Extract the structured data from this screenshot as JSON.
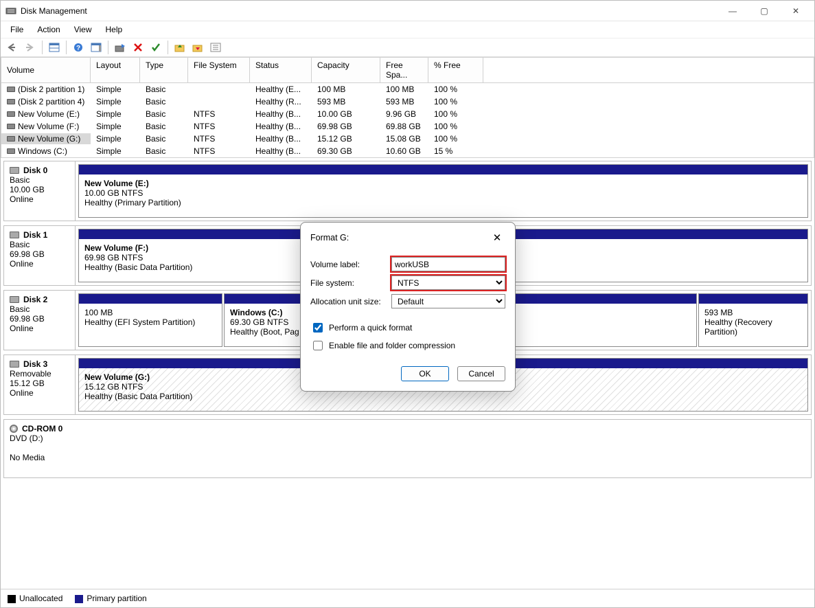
{
  "app_title": "Disk Management",
  "menu": {
    "file": "File",
    "action": "Action",
    "view": "View",
    "help": "Help"
  },
  "win_controls": {
    "min": "—",
    "max": "▢",
    "close": "✕"
  },
  "columns": {
    "volume": "Volume",
    "layout": "Layout",
    "type": "Type",
    "fs": "File System",
    "status": "Status",
    "capacity": "Capacity",
    "free": "Free Spa...",
    "pct": "% Free"
  },
  "volumes": [
    {
      "name": "(Disk 2 partition 1)",
      "layout": "Simple",
      "type": "Basic",
      "fs": "",
      "status": "Healthy (E...",
      "cap": "100 MB",
      "free": "100 MB",
      "pct": "100 %"
    },
    {
      "name": "(Disk 2 partition 4)",
      "layout": "Simple",
      "type": "Basic",
      "fs": "",
      "status": "Healthy (R...",
      "cap": "593 MB",
      "free": "593 MB",
      "pct": "100 %"
    },
    {
      "name": "New Volume (E:)",
      "layout": "Simple",
      "type": "Basic",
      "fs": "NTFS",
      "status": "Healthy (B...",
      "cap": "10.00 GB",
      "free": "9.96 GB",
      "pct": "100 %"
    },
    {
      "name": "New Volume (F:)",
      "layout": "Simple",
      "type": "Basic",
      "fs": "NTFS",
      "status": "Healthy (B...",
      "cap": "69.98 GB",
      "free": "69.88 GB",
      "pct": "100 %"
    },
    {
      "name": "New Volume (G:)",
      "layout": "Simple",
      "type": "Basic",
      "fs": "NTFS",
      "status": "Healthy (B...",
      "cap": "15.12 GB",
      "free": "15.08 GB",
      "pct": "100 %",
      "selected": true
    },
    {
      "name": "Windows (C:)",
      "layout": "Simple",
      "type": "Basic",
      "fs": "NTFS",
      "status": "Healthy (B...",
      "cap": "69.30 GB",
      "free": "10.60 GB",
      "pct": "15 %"
    }
  ],
  "disks": {
    "d0": {
      "title": "Disk 0",
      "type": "Basic",
      "size": "10.00 GB",
      "state": "Online",
      "p0": {
        "name": "New Volume  (E:)",
        "size": "10.00 GB NTFS",
        "status": "Healthy (Primary Partition)"
      }
    },
    "d1": {
      "title": "Disk 1",
      "type": "Basic",
      "size": "69.98 GB",
      "state": "Online",
      "p0": {
        "name": "New Volume  (F:)",
        "size": "69.98 GB NTFS",
        "status": "Healthy (Basic Data Partition)"
      }
    },
    "d2": {
      "title": "Disk 2",
      "type": "Basic",
      "size": "69.98 GB",
      "state": "Online",
      "p0": {
        "name": "",
        "size": "100 MB",
        "status": "Healthy (EFI System Partition)"
      },
      "p1": {
        "name": "Windows  (C:)",
        "size": "69.30 GB NTFS",
        "status": "Healthy (Boot, Pag"
      },
      "p2": {
        "name": "",
        "size": "593 MB",
        "status": "Healthy (Recovery Partition)"
      }
    },
    "d3": {
      "title": "Disk 3",
      "type": "Removable",
      "size": "15.12 GB",
      "state": "Online",
      "p0": {
        "name": "New Volume  (G:)",
        "size": "15.12 GB NTFS",
        "status": "Healthy (Basic Data Partition)"
      }
    },
    "cd": {
      "title": "CD-ROM 0",
      "type": "DVD (D:)",
      "state": "No Media"
    }
  },
  "legend": {
    "unalloc": "Unallocated",
    "primary": "Primary partition"
  },
  "dialog": {
    "title": "Format G:",
    "volume_label_lbl": "Volume label:",
    "volume_label_val": "workUSB",
    "fs_lbl": "File system:",
    "fs_val": "NTFS",
    "alloc_lbl": "Allocation unit size:",
    "alloc_val": "Default",
    "quick": "Perform a quick format",
    "compress": "Enable file and folder compression",
    "ok": "OK",
    "cancel": "Cancel"
  }
}
